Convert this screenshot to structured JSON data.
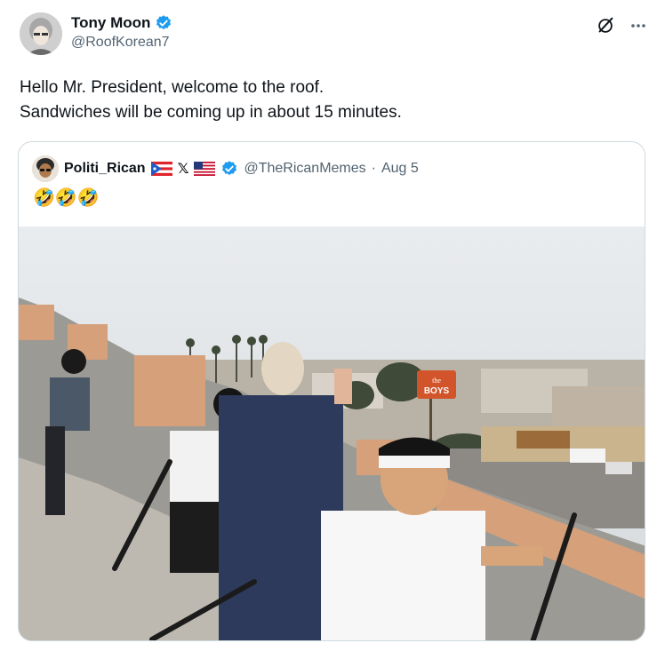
{
  "tweet": {
    "author": {
      "display_name": "Tony Moon",
      "handle": "@RoofKorean7"
    },
    "text": "Hello Mr. President, welcome to the roof.\nSandwiches will be coming up in about 15 minutes."
  },
  "quote": {
    "author": {
      "display_name": "Politi_Rican",
      "x_mark": "𝕏",
      "handle": "@TheRicanMemes",
      "separator": "·",
      "date": "Aug 5"
    },
    "text": "🤣🤣🤣",
    "image": {
      "sign_text_1": "the",
      "sign_text_2": "BOYS"
    }
  },
  "icons": {
    "verified": "verified-badge-icon",
    "grok": "grok-icon",
    "more": "more-icon"
  },
  "colors": {
    "verified_blue": "#1d9bf0",
    "secondary_text": "#536471",
    "border": "#cfd9de"
  }
}
